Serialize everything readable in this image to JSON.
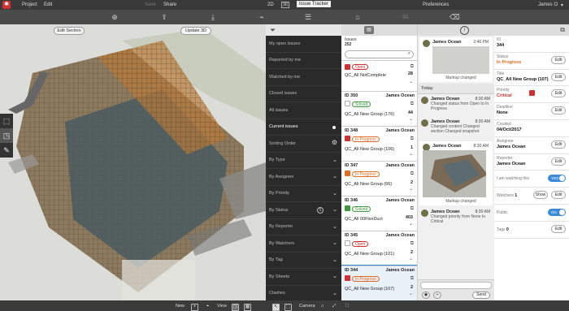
{
  "menu": {
    "project": "Project",
    "edit": "Edit",
    "save": "Save",
    "share": "Share",
    "mode_2d": "2D",
    "mode_3d": "3D",
    "issue_tracker": "Issue Tracker",
    "preferences": "Preferences",
    "user": "James O"
  },
  "viewer": {
    "edit_section": "Edit Section",
    "update_3d": "Update 3D"
  },
  "bottom": {
    "new": "New",
    "view": "View",
    "camera": "Camera"
  },
  "filter": {
    "items": [
      {
        "label": "My open issues"
      },
      {
        "label": "Reported by me"
      },
      {
        "label": "Watched by me"
      },
      {
        "label": "Closed issues"
      },
      {
        "label": "All issues"
      },
      {
        "label": "Current issues"
      },
      {
        "label": "Sorting Order"
      },
      {
        "label": "By Type"
      },
      {
        "label": "By Assignee"
      },
      {
        "label": "By Priority"
      },
      {
        "label": "By Status",
        "badge": "5"
      },
      {
        "label": "By Reporter"
      },
      {
        "label": "By Watchers"
      },
      {
        "label": "By Tag"
      },
      {
        "label": "By Sheets"
      },
      {
        "label": "Clashes"
      }
    ]
  },
  "issues": {
    "label": "Issues",
    "count": "252",
    "search_placeholder": "",
    "top": {
      "status": "Open",
      "group": "QC_All NotComplete",
      "num": "28"
    },
    "list": [
      {
        "id": "ID 350",
        "who": "James Ocean",
        "status": "Solved",
        "group": "QC_All New Group (176)",
        "num": "44"
      },
      {
        "id": "ID 348",
        "who": "James Ocean",
        "status": "In Progress",
        "group": "QC_All New Group (106)",
        "num": "1"
      },
      {
        "id": "ID 347",
        "who": "James Ocean",
        "status": "In Progress",
        "group": "QC_All New Group (66)",
        "num": "2"
      },
      {
        "id": "ID 346",
        "who": "James Ocean",
        "status": "Solved",
        "group": "QC_All 00FlexDuct",
        "num": "403"
      },
      {
        "id": "ID 345",
        "who": "James Ocean",
        "status": "Open",
        "group": "QC_All New Group (101)",
        "num": "2"
      },
      {
        "id": "ID 344",
        "who": "James Ocean",
        "status": "In Progress",
        "group": "QC_All New Group (107)",
        "num": "2"
      }
    ]
  },
  "comments": {
    "items": [
      {
        "name": "James Ocean",
        "time": "2:46 PM",
        "text": "Markup changed"
      },
      {
        "name": "James Ocean",
        "time": "8:30 AM",
        "text": "Changed status from Open to In Progress"
      },
      {
        "name": "James Ocean",
        "time": "8:30 AM",
        "text": "Changed content Changed section Changed snapshot"
      },
      {
        "name": "James Ocean",
        "time": "8:30 AM",
        "text": "Markup changed"
      },
      {
        "name": "James Ocean",
        "time": "8:30 AM",
        "text": "Changed priority from None to Critical"
      }
    ],
    "today": "Today",
    "send": "Send"
  },
  "details": {
    "id_label": "ID",
    "id": "344",
    "status_label": "Status",
    "status": "In Progress",
    "title_label": "Title",
    "title": "QC_All New Group (107)",
    "priority_label": "Priority",
    "priority": "Critical",
    "deadline_label": "Deadline",
    "deadline": "None",
    "created_label": "Created",
    "created": "04/Oct/2017",
    "assignee_label": "Assignee",
    "assignee": "James Ocean",
    "reporter_label": "Reporter",
    "reporter": "James Ocean",
    "watching_label": "I am watching this",
    "watching": "YES",
    "watchers_label": "Watchers",
    "watchers": "1",
    "show": "Show",
    "public_label": "Public",
    "public": "ON",
    "tags_label": "Tags",
    "tags": "0",
    "edit": "Edit"
  },
  "colors": {
    "accent": "#3b8bd8",
    "in_progress": "#e06a20",
    "solved": "#3a9a3a",
    "open": "#d03030",
    "toolbar": "#4a4a4a"
  }
}
